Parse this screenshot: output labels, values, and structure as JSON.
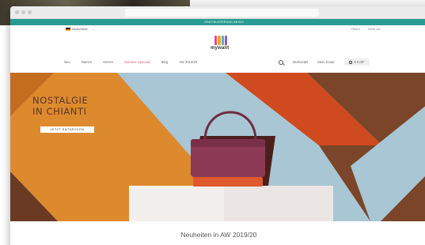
{
  "promo_text": "GRATISLIEFERUNG AB €49",
  "country": "Deutschland",
  "top_links": [
    "Filialen",
    "Ueber uns"
  ],
  "logo": {
    "text": "mywalit",
    "colors": [
      "#e84a8a",
      "#f7a531",
      "#4bb0d8",
      "#8c5fbf"
    ]
  },
  "nav": {
    "items": [
      "Neu",
      "Damen",
      "Herren",
      "Sommer Specials",
      "Blog",
      "AW 2019/20"
    ],
    "active_index": 3,
    "wishlist": "Merkzettel",
    "account": "Mein Konto",
    "cart_total": "€ 0,00*"
  },
  "hero": {
    "title_line1": "NOSTALGIE",
    "title_line2": "IN CHIANTI",
    "cta": "JETZT ENTDECKEN"
  },
  "section_title": "Neuheiten in AW 2019/20",
  "colors": {
    "accent": "#2a9b93",
    "nav_active": "#e4607a"
  }
}
